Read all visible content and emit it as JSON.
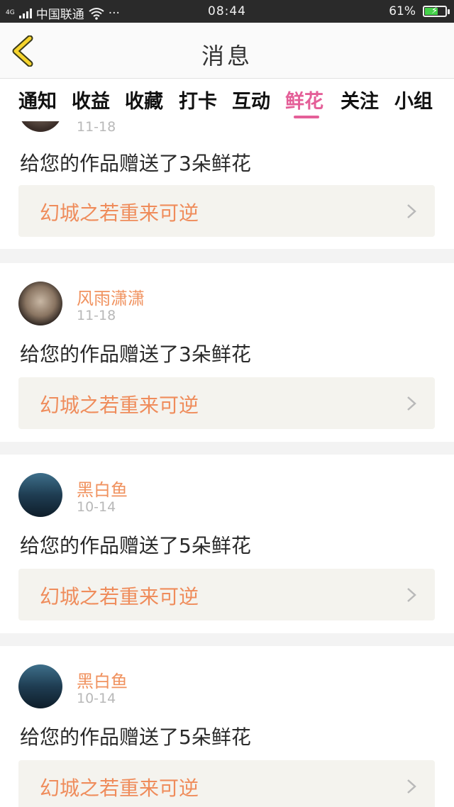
{
  "status_bar": {
    "network": "4G",
    "carrier": "中国联通",
    "dots": "···",
    "time": "08:44",
    "battery": "61%",
    "battery_level": 0.61
  },
  "header": {
    "title": "消息"
  },
  "tabs": [
    {
      "label": "通知"
    },
    {
      "label": "收益"
    },
    {
      "label": "收藏"
    },
    {
      "label": "打卡"
    },
    {
      "label": "互动"
    },
    {
      "label": "鲜花",
      "active": true
    },
    {
      "label": "关注"
    },
    {
      "label": "小组"
    }
  ],
  "messages": [
    {
      "user": "",
      "date": "11-18",
      "text": "给您的作品赠送了3朵鲜花",
      "work": "幻城之若重来可逆"
    },
    {
      "user": "风雨潇潇",
      "date": "11-18",
      "text": "给您的作品赠送了3朵鲜花",
      "work": "幻城之若重来可逆"
    },
    {
      "user": "黑白鱼",
      "date": "10-14",
      "text": "给您的作品赠送了5朵鲜花",
      "work": "幻城之若重来可逆"
    },
    {
      "user": "黑白鱼",
      "date": "10-14",
      "text": "给您的作品赠送了5朵鲜花",
      "work": "幻城之若重来可逆"
    }
  ],
  "colors": {
    "accent": "#e45f98",
    "username": "#f0925f",
    "work_title": "#ef8c5b"
  }
}
